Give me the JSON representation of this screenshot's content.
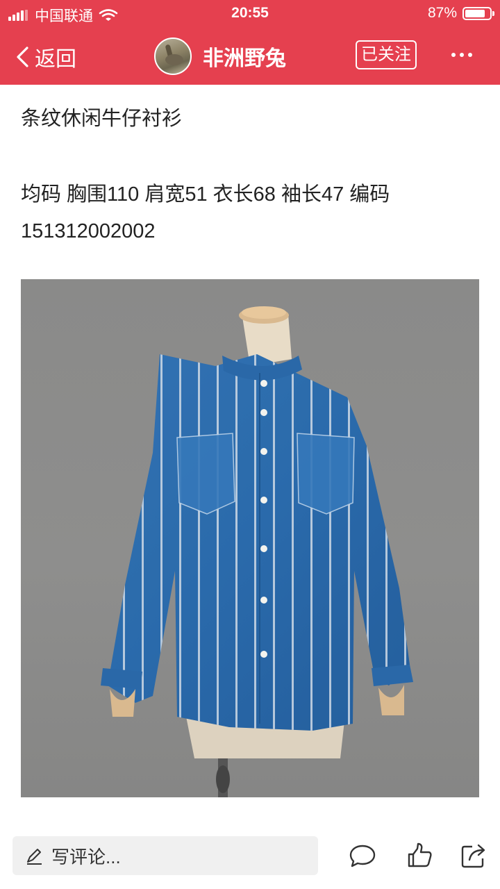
{
  "status": {
    "carrier": "中国联通",
    "time": "20:55",
    "battery": "87%",
    "battery_level": 0.87,
    "signal_bars": 4
  },
  "nav": {
    "back_label": "返回",
    "author_name": "非洲野兔",
    "follow_label": "已关注"
  },
  "post": {
    "title": "条纹休闲牛仔衬衫",
    "specs": "均码  胸围110   肩宽51  衣长68  袖长47   编码151312002002"
  },
  "bottom": {
    "comment_placeholder": "写评论..."
  },
  "colors": {
    "brand": "#e5404f",
    "denim": "#2d6fb2"
  },
  "icons": [
    "back-chevron-icon",
    "more-icon",
    "pencil-icon",
    "comment-bubble-icon",
    "thumbs-up-icon",
    "share-icon",
    "wifi-icon",
    "signal-icon",
    "battery-icon"
  ]
}
